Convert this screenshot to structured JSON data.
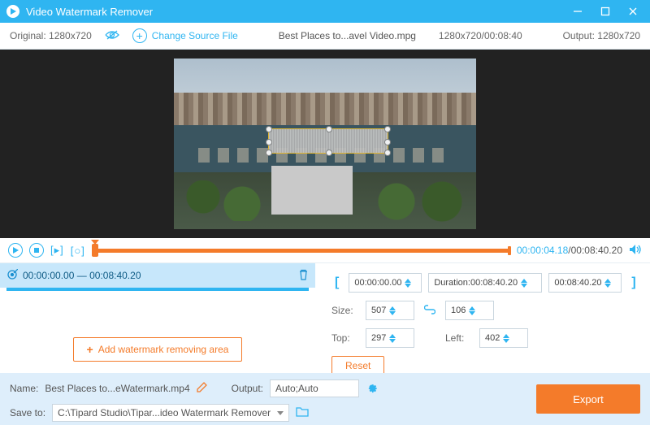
{
  "title": "Video Watermark Remover",
  "toolbar": {
    "original_label": "Original:",
    "original_value": "1280x720",
    "change_source": "Change Source File",
    "file_name": "Best Places to...avel Video.mpg",
    "file_dims_time": "1280x720/00:08:40",
    "output_label": "Output:",
    "output_value": "1280x720"
  },
  "playback": {
    "current_time": "00:00:04.18",
    "sep": "/",
    "total_time": "00:08:40.20"
  },
  "segment": {
    "start": "00:00:00.00",
    "dash": "—",
    "end": "00:08:40.20"
  },
  "add_area_label": "Add watermark removing area",
  "range": {
    "start": "00:00:00.00",
    "duration_label": "Duration:",
    "duration_value": "00:08:40.20",
    "end": "00:08:40.20"
  },
  "size": {
    "label": "Size:",
    "w": "507",
    "h": "106"
  },
  "pos": {
    "top_label": "Top:",
    "top": "297",
    "left_label": "Left:",
    "left": "402"
  },
  "reset_label": "Reset",
  "bottom": {
    "name_label": "Name:",
    "name_value": "Best Places to...eWatermark.mp4",
    "output_label": "Output:",
    "output_value": "Auto;Auto",
    "save_label": "Save to:",
    "save_path": "C:\\Tipard Studio\\Tipar...ideo Watermark Remover",
    "export_label": "Export"
  }
}
